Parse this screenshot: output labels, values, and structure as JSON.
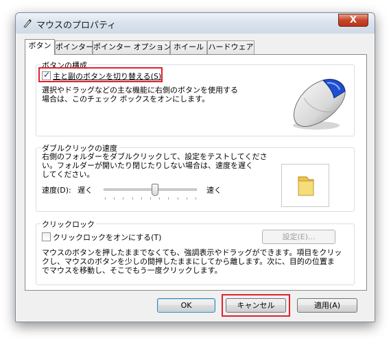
{
  "window": {
    "title": "マウスのプロパティ",
    "close_label": "X"
  },
  "tabs": [
    {
      "label": "ボタン",
      "active": true
    },
    {
      "label": "ポインター",
      "active": false
    },
    {
      "label": "ポインター オプション",
      "active": false
    },
    {
      "label": "ホイール",
      "active": false
    },
    {
      "label": "ハードウェア",
      "active": false
    }
  ],
  "button_config": {
    "group_label": "ボタンの構成",
    "checkbox_label": "主と副のボタンを切り替える",
    "checkbox_accel": "(S)",
    "checked": true,
    "description": "選択やドラッグなどの主な機能に右側のボタンを使用する\n場合は、このチェック ボックスをオンにします。"
  },
  "double_click": {
    "group_label": "ダブルクリックの速度",
    "description": "右側のフォルダーをダブルクリックして、設定をテストしてくださ\nい。フォルダーが開いたり閉じたりしない場合は、速度を遅く\nしてください。",
    "speed_label": "速度(D):",
    "slow_label": "遅く",
    "fast_label": "速く",
    "speed_level": 0.55
  },
  "click_lock": {
    "group_label": "クリックロック",
    "checkbox_label": "クリックロックをオンにする(T)",
    "checked": false,
    "settings_button": "設定(E)...",
    "description": "マウスのボタンを押したままでなくても、強調表示やドラッグができます。項目をクリッ\nクし、マウスのボタンを少しの間押したままにしてから離します。次に、目的の位置ま\nでマウスを移動し、そこでもう一度クリックします。"
  },
  "footer": {
    "ok": "OK",
    "cancel": "キャンセル",
    "apply": "適用(A)"
  },
  "colors": {
    "highlight_box": "#e0202a",
    "titlebar": "#dbe4ee",
    "close_button": "#c7462a"
  }
}
